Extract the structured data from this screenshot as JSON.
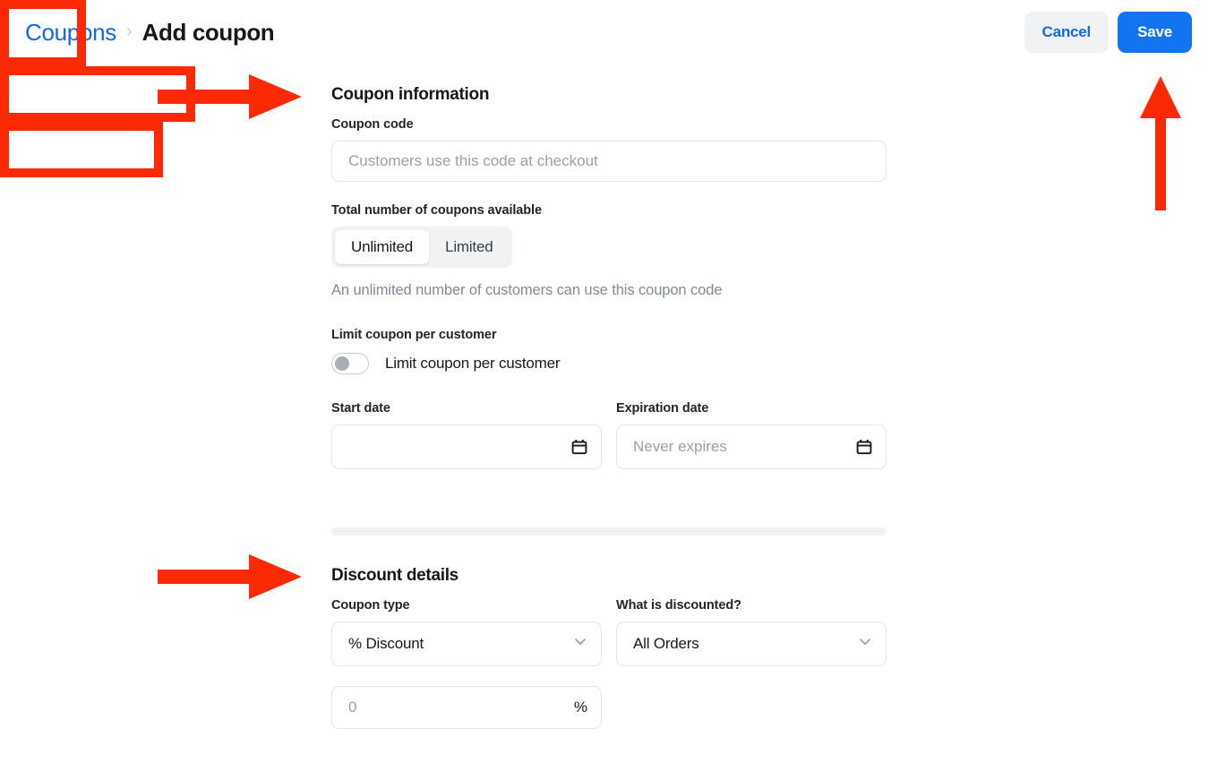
{
  "header": {
    "breadcrumb_parent": "Coupons",
    "breadcrumb_separator": "›",
    "breadcrumb_current": "Add coupon",
    "cancel_label": "Cancel",
    "save_label": "Save"
  },
  "coupon_information": {
    "section_title": "Coupon information",
    "coupon_code_label": "Coupon code",
    "coupon_code_value": "",
    "coupon_code_placeholder": "Customers use this code at checkout",
    "total_coupons_label": "Total number of coupons available",
    "segment_unlimited": "Unlimited",
    "segment_limited": "Limited",
    "segment_selected": "Unlimited",
    "availability_help": "An unlimited number of customers can use this coupon code",
    "limit_per_customer_label": "Limit coupon per customer",
    "limit_per_customer_toggle_label": "Limit coupon per customer",
    "limit_per_customer_enabled": false,
    "start_date_label": "Start date",
    "start_date_value": "",
    "start_date_placeholder": "",
    "expiration_date_label": "Expiration date",
    "expiration_date_value": "",
    "expiration_date_placeholder": "Never expires"
  },
  "discount_details": {
    "section_title": "Discount details",
    "coupon_type_label": "Coupon type",
    "coupon_type_value": "% Discount",
    "what_discounted_label": "What is discounted?",
    "what_discounted_value": "All Orders",
    "amount_value": "",
    "amount_placeholder": "0",
    "amount_suffix": "%"
  },
  "annotations": {
    "color": "#fb2a05",
    "arrow_coupon_information": "arrow-right",
    "arrow_discount_details": "arrow-right",
    "arrow_save": "arrow-up",
    "box_coupon_information": "highlight-box",
    "box_discount_details": "highlight-box",
    "box_save": "highlight-box"
  },
  "colors": {
    "accent_blue": "#1274ee",
    "link_blue": "#1068ef",
    "annotation_red": "#fb2a05",
    "text_primary": "#16181c",
    "text_muted": "#848a93",
    "border": "#e2e4e8",
    "surface_gray": "#f1f2f4"
  }
}
